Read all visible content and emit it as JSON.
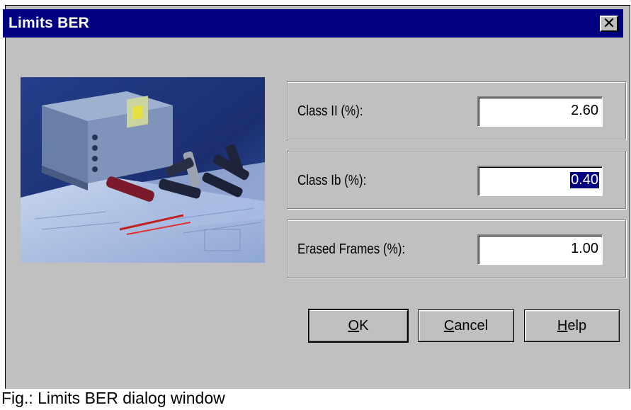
{
  "window": {
    "title": "Limits BER",
    "close_glyph": "✕"
  },
  "photo": {
    "description_icon": "product-photo"
  },
  "fields": [
    {
      "label": "Class II (%):",
      "value": "2.60",
      "selected": false
    },
    {
      "label": "Class Ib (%):",
      "value": "0.40",
      "selected": true
    },
    {
      "label": "Erased Frames (%):",
      "value": "1.00",
      "selected": false
    }
  ],
  "buttons": {
    "ok": {
      "mnemonic": "O",
      "rest": "K"
    },
    "cancel": {
      "mnemonic": "C",
      "rest": "ancel"
    },
    "help": {
      "mnemonic": "H",
      "rest": "elp"
    }
  },
  "caption": "Fig.: Limits BER dialog window",
  "colors": {
    "titlebar": "#000080",
    "dialog": "#c0c0c0",
    "selection": "#000080"
  }
}
